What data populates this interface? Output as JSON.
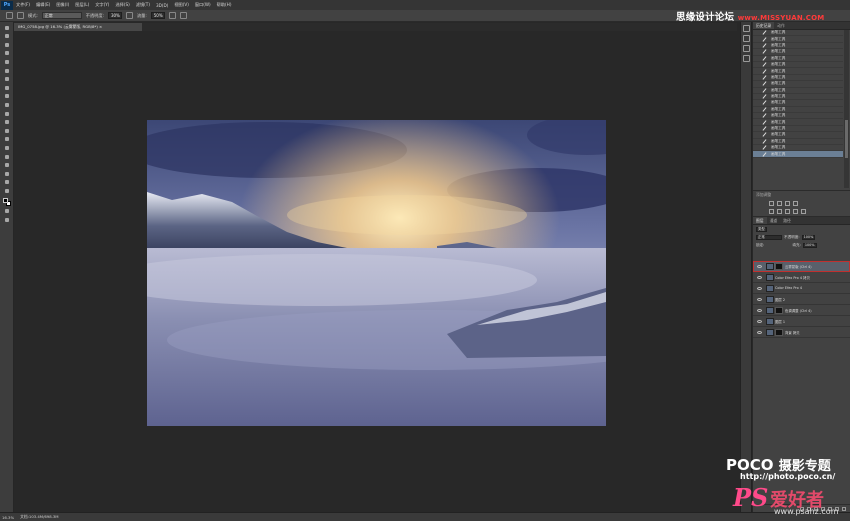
{
  "app": {
    "logo": "Ps"
  },
  "menu": [
    "文件(F)",
    "编辑(E)",
    "图像(I)",
    "图层(L)",
    "文字(Y)",
    "选择(S)",
    "滤镜(T)",
    "3D(D)",
    "视图(V)",
    "窗口(W)",
    "帮助(H)"
  ],
  "options": {
    "mode_label": "模式:",
    "mode_value": "正常",
    "opacity_label": "不透明度:",
    "opacity_value": "30%",
    "flow_label": "流量:",
    "flow_value": "50%"
  },
  "document": {
    "tab_title": "IMG_0758.jpg @ 16.3% (云雾蒙版, RGB/8*) ×"
  },
  "history": {
    "tabs": [
      "历史记录",
      "动作"
    ],
    "items": [
      "画笔工具",
      "画笔工具",
      "画笔工具",
      "画笔工具",
      "画笔工具",
      "画笔工具",
      "画笔工具",
      "画笔工具",
      "画笔工具",
      "画笔工具",
      "画笔工具",
      "画笔工具",
      "画笔工具",
      "画笔工具",
      "画笔工具",
      "画笔工具",
      "画笔工具",
      "画笔工具",
      "画笔工具",
      "画笔工具"
    ],
    "active_index": 19,
    "scroll_fraction": 0.75
  },
  "adjustments": {
    "title": "添加调整"
  },
  "layers": {
    "tabs": [
      "图层",
      "通道",
      "路径"
    ],
    "kind_label": "类型",
    "blend_mode": "正常",
    "opacity_label": "不透明度:",
    "opacity_value": "100%",
    "lock_label": "锁定:",
    "fill_label": "填充:",
    "fill_value": "100%",
    "items": [
      {
        "name": "云雾蒙版 (Ctrl 4)",
        "selected": true,
        "has_mask": true
      },
      {
        "name": "Color Efex Pro 4 拷贝",
        "selected": false,
        "has_mask": false
      },
      {
        "name": "Color Efex Pro 4",
        "selected": false,
        "has_mask": false
      },
      {
        "name": "图层 2",
        "selected": false,
        "has_mask": false
      },
      {
        "name": "色调调整 (Ctrl 4)",
        "selected": false,
        "has_mask": true
      },
      {
        "name": "图层 1",
        "selected": false,
        "has_mask": false
      },
      {
        "name": "背景 拷贝",
        "selected": false,
        "has_mask": true
      }
    ]
  },
  "status": {
    "zoom": "16.3%",
    "doc_info": "文档:103.4M/698.3M"
  },
  "watermarks": {
    "top_cn": "思缘设计论坛",
    "top_url": "www.MISSYUAN.COM",
    "poco_brand": "POCO",
    "poco_sub": "摄影专题",
    "poco_url": "http://photo.poco.cn/",
    "ps_big": "PS",
    "ps_cn": "爱好者",
    "ps_url": "www.psahz.com"
  },
  "colors": {
    "accent_selected": "#c0302f",
    "history_active": "#6b7f95"
  }
}
